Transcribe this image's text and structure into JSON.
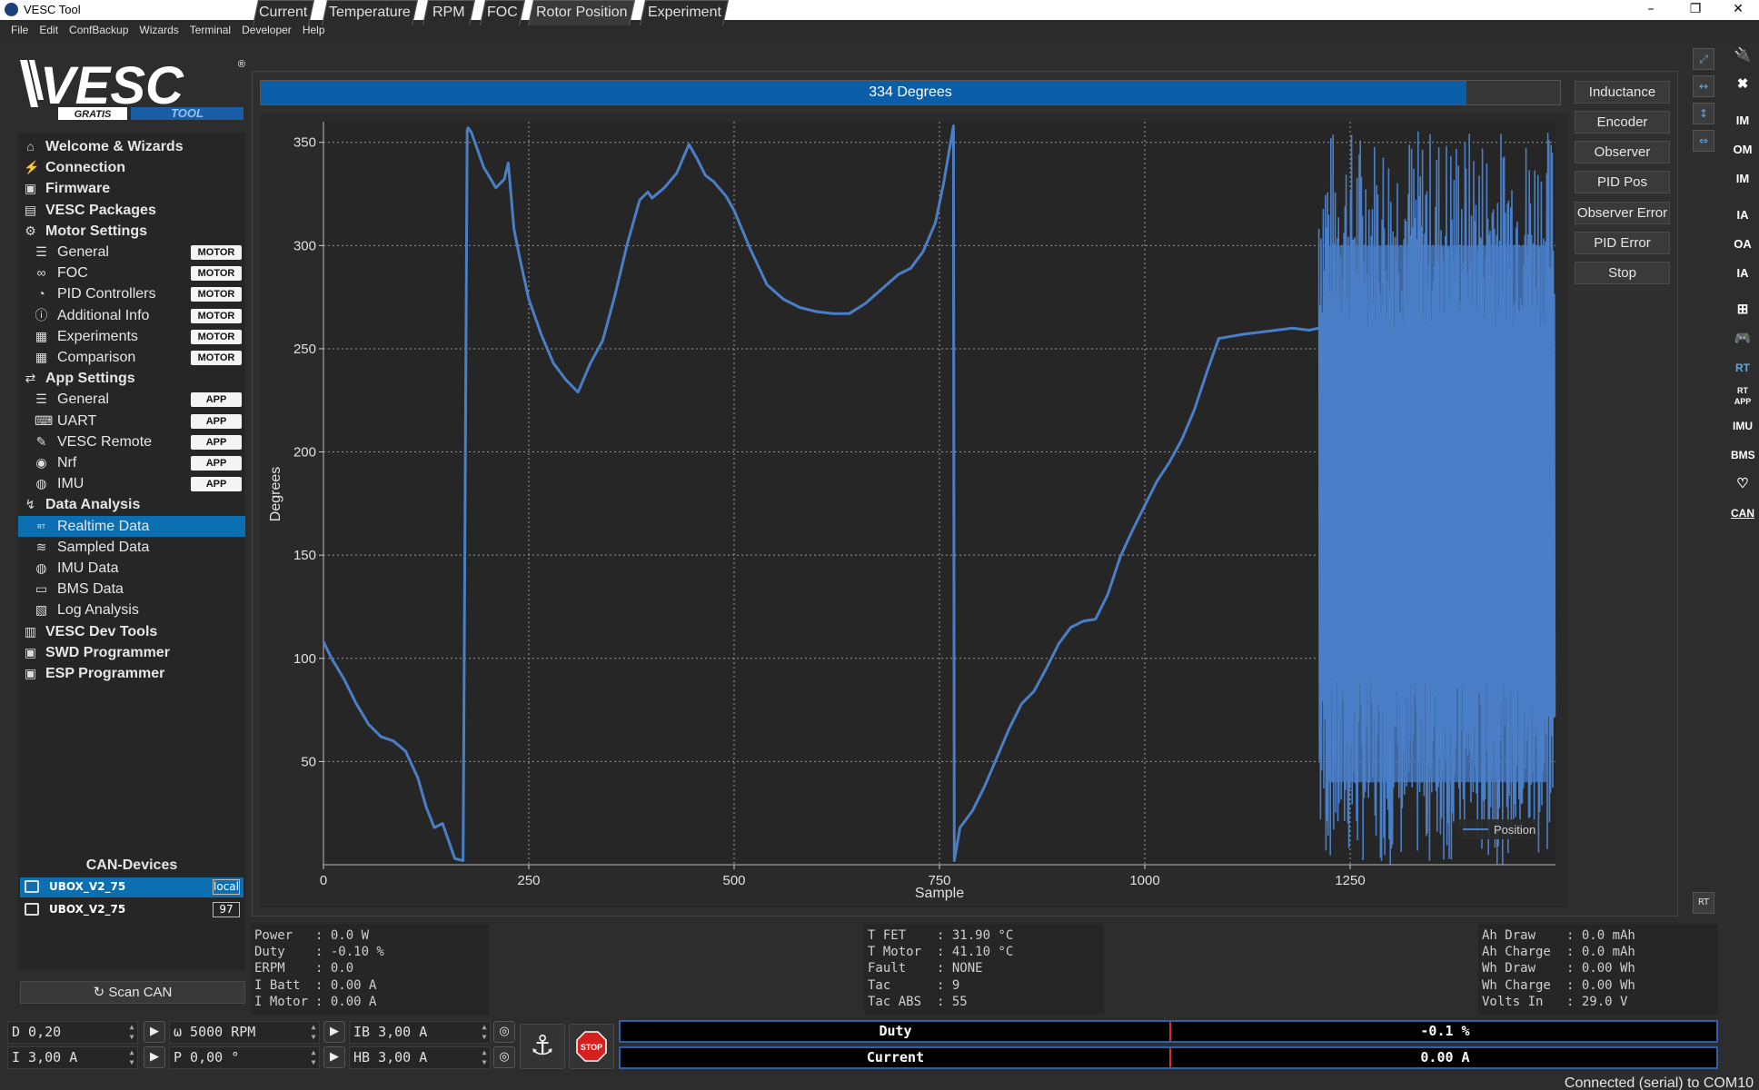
{
  "window": {
    "title": "VESC Tool"
  },
  "menu": [
    "File",
    "Edit",
    "ConfBackup",
    "Wizards",
    "Terminal",
    "Developer",
    "Help"
  ],
  "logo": {
    "main": "VESC",
    "left": "GRATIS",
    "right": "TOOL"
  },
  "nav": [
    {
      "label": "Welcome & Wizards",
      "level": "top",
      "icon": "home-icon"
    },
    {
      "label": "Connection",
      "level": "top",
      "icon": "plug-icon"
    },
    {
      "label": "Firmware",
      "level": "top",
      "icon": "chip-icon"
    },
    {
      "label": "VESC Packages",
      "level": "top",
      "icon": "package-icon"
    },
    {
      "label": "Motor Settings",
      "level": "top",
      "icon": "motor-icon"
    },
    {
      "label": "General",
      "level": "sub",
      "icon": "sliders-icon",
      "tag": "MOTOR"
    },
    {
      "label": "FOC",
      "level": "sub",
      "icon": "coil-icon",
      "tag": "MOTOR"
    },
    {
      "label": "PID Controllers",
      "level": "sub",
      "icon": "gauge-icon",
      "tag": "MOTOR"
    },
    {
      "label": "Additional Info",
      "level": "sub",
      "icon": "info-icon",
      "tag": "MOTOR"
    },
    {
      "label": "Experiments",
      "level": "sub",
      "icon": "calculator-icon",
      "tag": "MOTOR"
    },
    {
      "label": "Comparison",
      "level": "sub",
      "icon": "calculator-icon",
      "tag": "MOTOR"
    },
    {
      "label": "App Settings",
      "level": "top",
      "icon": "app-settings-icon"
    },
    {
      "label": "General",
      "level": "sub",
      "icon": "sliders-icon",
      "tag": "APP"
    },
    {
      "label": "UART",
      "level": "sub",
      "icon": "keyboard-icon",
      "tag": "APP"
    },
    {
      "label": "VESC Remote",
      "level": "sub",
      "icon": "remote-icon",
      "tag": "APP"
    },
    {
      "label": "Nrf",
      "level": "sub",
      "icon": "wireless-icon",
      "tag": "APP"
    },
    {
      "label": "IMU",
      "level": "sub",
      "icon": "imu-icon",
      "tag": "APP"
    },
    {
      "label": "Data Analysis",
      "level": "top",
      "icon": "analysis-icon"
    },
    {
      "label": "Realtime Data",
      "level": "sub",
      "icon": "realtime-icon",
      "selected": true
    },
    {
      "label": "Sampled Data",
      "level": "sub",
      "icon": "sampled-icon"
    },
    {
      "label": "IMU Data",
      "level": "sub",
      "icon": "imu-icon"
    },
    {
      "label": "BMS Data",
      "level": "sub",
      "icon": "battery-icon"
    },
    {
      "label": "Log Analysis",
      "level": "sub",
      "icon": "log-icon"
    },
    {
      "label": "VESC Dev Tools",
      "level": "top",
      "icon": "devtools-icon"
    },
    {
      "label": "SWD Programmer",
      "level": "top",
      "icon": "chip-icon"
    },
    {
      "label": "ESP Programmer",
      "level": "top",
      "icon": "chip-icon"
    }
  ],
  "can": {
    "header": "CAN-Devices",
    "devices": [
      {
        "name": "UBOX_V2_75",
        "id": "local",
        "selected": true
      },
      {
        "name": "UBOX_V2_75",
        "id": "97",
        "selected": false
      }
    ],
    "scan_label": "Scan CAN"
  },
  "tabs": [
    {
      "label": "Current"
    },
    {
      "label": "Temperature"
    },
    {
      "label": "RPM"
    },
    {
      "label": "FOC"
    },
    {
      "label": "Rotor Position",
      "selected": true
    },
    {
      "label": "Experiment"
    }
  ],
  "rotor": {
    "progress_text": "334 Degrees",
    "progress_value": 334,
    "progress_max": 360
  },
  "side_buttons": [
    "Inductance",
    "Encoder",
    "Observer",
    "PID Pos",
    "Observer Error",
    "PID Error",
    "Stop"
  ],
  "chart_data": {
    "type": "line",
    "xlabel": "Sample",
    "ylabel": "Degrees",
    "xlim": [
      0,
      1500
    ],
    "ylim": [
      0,
      360
    ],
    "xticks": [
      0,
      250,
      500,
      750,
      1000,
      1250
    ],
    "yticks": [
      50,
      100,
      150,
      200,
      250,
      300,
      350
    ],
    "grid": true,
    "legend": "bottom-right",
    "series": [
      {
        "name": "Position",
        "color": "#4a7fc8",
        "x": [
          0,
          10,
          25,
          40,
          55,
          70,
          85,
          100,
          115,
          125,
          135,
          145,
          160,
          170,
          175,
          176,
          180,
          195,
          210,
          220,
          225,
          232,
          240,
          250,
          265,
          280,
          295,
          310,
          325,
          340,
          355,
          370,
          385,
          395,
          400,
          415,
          430,
          445,
          455,
          465,
          475,
          490,
          500,
          520,
          540,
          560,
          580,
          600,
          620,
          640,
          660,
          680,
          700,
          715,
          730,
          745,
          755,
          767,
          768,
          775,
          790,
          805,
          820,
          835,
          850,
          865,
          880,
          895,
          910,
          925,
          940,
          955,
          970,
          985,
          1000,
          1015,
          1030,
          1045,
          1060,
          1075,
          1090,
          1105,
          1120,
          1140,
          1160,
          1180,
          1200,
          1212
        ],
        "y": [
          108,
          100,
          90,
          78,
          68,
          62,
          60,
          55,
          42,
          28,
          18,
          20,
          3,
          2,
          356,
          357,
          355,
          338,
          328,
          332,
          340,
          308,
          292,
          274,
          257,
          243,
          235,
          229,
          243,
          254,
          276,
          301,
          322,
          326,
          323,
          328,
          335,
          349,
          342,
          334,
          331,
          324,
          317,
          298,
          281,
          274,
          270,
          268,
          267,
          267,
          272,
          279,
          286,
          289,
          297,
          311,
          330,
          358,
          2,
          18,
          26,
          38,
          52,
          66,
          78,
          84,
          95,
          107,
          115,
          118,
          119,
          131,
          149,
          162,
          174,
          186,
          195,
          206,
          220,
          238,
          255,
          256,
          257,
          258,
          259,
          260,
          259,
          260
        ]
      }
    ],
    "noise_region": {
      "x_start": 1212,
      "x_end": 1500,
      "y_min": 0,
      "y_max": 358
    }
  },
  "stats_left": [
    [
      "Power",
      "0.0 W"
    ],
    [
      "Duty",
      "-0.10 %"
    ],
    [
      "ERPM",
      "0.0"
    ],
    [
      "I Batt",
      "0.00 A"
    ],
    [
      "I Motor",
      "0.00 A"
    ]
  ],
  "stats_mid": [
    [
      "T FET",
      "31.90 °C"
    ],
    [
      "T Motor",
      "41.10 °C"
    ],
    [
      "Fault",
      "NONE"
    ],
    [
      "Tac",
      "9"
    ],
    [
      "Tac ABS",
      "55"
    ]
  ],
  "stats_right": [
    [
      "Ah Draw",
      "0.0 mAh"
    ],
    [
      "Ah Charge",
      "0.0 mAh"
    ],
    [
      "Wh Draw",
      "0.00 Wh"
    ],
    [
      "Wh Charge",
      "0.00 Wh"
    ],
    [
      "Volts In",
      "29.0 V"
    ]
  ],
  "controls": {
    "duty": "D 0,20",
    "current": "I 3,00 A",
    "rpm": "ω 5000 RPM",
    "pos": "P 0,00 °",
    "brake": "IB 3,00 A",
    "handbrake": "HB 3,00 A",
    "stop_label": "STOP"
  },
  "bars": {
    "duty_label": "Duty",
    "duty_value": "-0.1 %",
    "current_label": "Current",
    "current_value": "0.00 A"
  },
  "toolbar_right": [
    "IM",
    "OM",
    "IM",
    "IA",
    "OA",
    "IA",
    "RT",
    "RT APP",
    "IMU",
    "BMS",
    "CAN"
  ],
  "status": "Connected (serial) to COM10"
}
